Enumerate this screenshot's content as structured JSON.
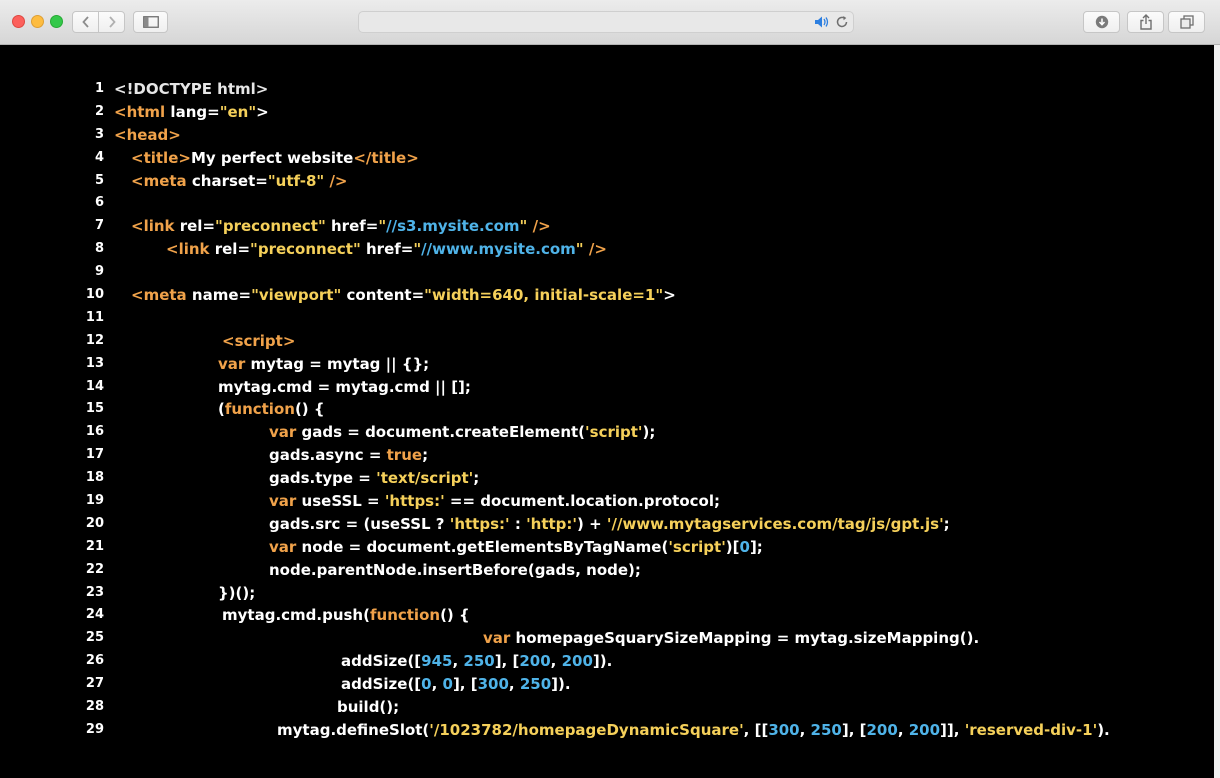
{
  "colors": {
    "tag": "#f0a24a",
    "keyword": "#f0a24a",
    "string": "#f5d05a",
    "url": "#4fb3e8",
    "number": "#4fb3e8",
    "plain": "#ffffff",
    "background": "#000000"
  },
  "toolbar": {
    "icons": [
      "close-icon",
      "minimize-icon",
      "zoom-icon",
      "back-icon",
      "forward-icon",
      "sidebar-icon",
      "speaker-icon",
      "reload-icon",
      "download-icon",
      "share-icon",
      "tabs-icon"
    ]
  },
  "code": {
    "lines": [
      {
        "n": "1",
        "indent": 114,
        "parts": [
          [
            "doc",
            "<!DOCTYPE html>"
          ]
        ]
      },
      {
        "n": "2",
        "indent": 114,
        "parts": [
          [
            "tag",
            "<html"
          ],
          [
            "plain",
            " lang="
          ],
          [
            "str",
            "\"en\""
          ],
          [
            "plain",
            ">"
          ]
        ]
      },
      {
        "n": "3",
        "indent": 114,
        "parts": [
          [
            "tag",
            "<head>"
          ]
        ]
      },
      {
        "n": "4",
        "indent": 131,
        "parts": [
          [
            "tag",
            "<title>"
          ],
          [
            "plain",
            "My perfect website"
          ],
          [
            "tag",
            "</title>"
          ]
        ]
      },
      {
        "n": "5",
        "indent": 131,
        "parts": [
          [
            "tag",
            "<meta"
          ],
          [
            "plain",
            " charset="
          ],
          [
            "str",
            "\"utf-8\""
          ],
          [
            "tag",
            " />"
          ]
        ]
      },
      {
        "n": "6",
        "indent": 131,
        "parts": []
      },
      {
        "n": "7",
        "indent": 131,
        "parts": [
          [
            "tag",
            "<link"
          ],
          [
            "plain",
            " rel="
          ],
          [
            "str",
            "\"preconnect\""
          ],
          [
            "plain",
            " href="
          ],
          [
            "str",
            "\""
          ],
          [
            "url",
            "//s3.mysite.com"
          ],
          [
            "str",
            "\""
          ],
          [
            "tag",
            " />"
          ]
        ]
      },
      {
        "n": "8",
        "indent": 166,
        "parts": [
          [
            "tag",
            "<link"
          ],
          [
            "plain",
            " rel="
          ],
          [
            "str",
            "\"preconnect\""
          ],
          [
            "plain",
            " href="
          ],
          [
            "str",
            "\""
          ],
          [
            "url",
            "//www.mysite.com"
          ],
          [
            "str",
            "\""
          ],
          [
            "tag",
            " />"
          ]
        ]
      },
      {
        "n": "9",
        "indent": 131,
        "parts": []
      },
      {
        "n": "10",
        "indent": 131,
        "parts": [
          [
            "tag",
            "<meta"
          ],
          [
            "plain",
            " name="
          ],
          [
            "str",
            "\"viewport\""
          ],
          [
            "plain",
            " content="
          ],
          [
            "str",
            "\"width=640, initial-scale=1\""
          ],
          [
            "plain",
            ">"
          ]
        ]
      },
      {
        "n": "11",
        "indent": 131,
        "parts": []
      },
      {
        "n": "12",
        "indent": 222,
        "parts": [
          [
            "tag",
            "<script>"
          ]
        ]
      },
      {
        "n": "13",
        "indent": 218,
        "parts": [
          [
            "kw",
            "var"
          ],
          [
            "plain",
            " mytag = mytag || {};"
          ]
        ]
      },
      {
        "n": "14",
        "indent": 218,
        "parts": [
          [
            "plain",
            "mytag.cmd = mytag.cmd || [];"
          ]
        ]
      },
      {
        "n": "15",
        "indent": 218,
        "parts": [
          [
            "plain",
            "("
          ],
          [
            "kw",
            "function"
          ],
          [
            "plain",
            "() {"
          ]
        ]
      },
      {
        "n": "16",
        "indent": 269,
        "parts": [
          [
            "kw",
            "var"
          ],
          [
            "plain",
            " gads = document.createElement("
          ],
          [
            "str",
            "'script'"
          ],
          [
            "plain",
            ");"
          ]
        ]
      },
      {
        "n": "17",
        "indent": 269,
        "parts": [
          [
            "plain",
            "gads.async = "
          ],
          [
            "kw",
            "true"
          ],
          [
            "plain",
            ";"
          ]
        ]
      },
      {
        "n": "18",
        "indent": 269,
        "parts": [
          [
            "plain",
            "gads.type = "
          ],
          [
            "str",
            "'text/script'"
          ],
          [
            "plain",
            ";"
          ]
        ]
      },
      {
        "n": "19",
        "indent": 269,
        "parts": [
          [
            "kw",
            "var"
          ],
          [
            "plain",
            " useSSL = "
          ],
          [
            "str",
            "'https:'"
          ],
          [
            "plain",
            " == document.location.protocol;"
          ]
        ]
      },
      {
        "n": "20",
        "indent": 269,
        "parts": [
          [
            "plain",
            "gads.src = (useSSL ? "
          ],
          [
            "str",
            "'https:'"
          ],
          [
            "plain",
            " : "
          ],
          [
            "str",
            "'http:'"
          ],
          [
            "plain",
            ") + "
          ],
          [
            "str",
            "'//www.mytagservices.com/tag/js/gpt.js'"
          ],
          [
            "plain",
            ";"
          ]
        ]
      },
      {
        "n": "21",
        "indent": 269,
        "parts": [
          [
            "kw",
            "var"
          ],
          [
            "plain",
            " node = document.getElementsByTagName("
          ],
          [
            "str",
            "'script'"
          ],
          [
            "plain",
            ")["
          ],
          [
            "num",
            "0"
          ],
          [
            "plain",
            "];"
          ]
        ]
      },
      {
        "n": "22",
        "indent": 269,
        "parts": [
          [
            "plain",
            "node.parentNode.insertBefore(gads, node);"
          ]
        ]
      },
      {
        "n": "23",
        "indent": 218,
        "parts": [
          [
            "plain",
            "})();"
          ]
        ]
      },
      {
        "n": "24",
        "indent": 222,
        "parts": [
          [
            "plain",
            "mytag.cmd.push("
          ],
          [
            "kw",
            "function"
          ],
          [
            "plain",
            "() {"
          ]
        ]
      },
      {
        "n": "25",
        "indent": 483,
        "parts": [
          [
            "kw",
            "var"
          ],
          [
            "plain",
            " homepageSquarySizeMapping = mytag.sizeMapping()."
          ]
        ]
      },
      {
        "n": "26",
        "indent": 341,
        "parts": [
          [
            "plain",
            "addSize(["
          ],
          [
            "num",
            "945"
          ],
          [
            "plain",
            ", "
          ],
          [
            "num",
            "250"
          ],
          [
            "plain",
            "], ["
          ],
          [
            "num",
            "200"
          ],
          [
            "plain",
            ", "
          ],
          [
            "num",
            "200"
          ],
          [
            "plain",
            "])."
          ]
        ]
      },
      {
        "n": "27",
        "indent": 341,
        "parts": [
          [
            "plain",
            "addSize(["
          ],
          [
            "num",
            "0"
          ],
          [
            "plain",
            ", "
          ],
          [
            "num",
            "0"
          ],
          [
            "plain",
            "], ["
          ],
          [
            "num",
            "300"
          ],
          [
            "plain",
            ", "
          ],
          [
            "num",
            "250"
          ],
          [
            "plain",
            "])."
          ]
        ]
      },
      {
        "n": "28",
        "indent": 337,
        "parts": [
          [
            "plain",
            "build();"
          ]
        ]
      },
      {
        "n": "29",
        "indent": 277,
        "parts": [
          [
            "plain",
            "mytag.defineSlot("
          ],
          [
            "str",
            "'/1023782/homepageDynamicSquare'"
          ],
          [
            "plain",
            ", [["
          ],
          [
            "num",
            "300"
          ],
          [
            "plain",
            ", "
          ],
          [
            "num",
            "250"
          ],
          [
            "plain",
            "], ["
          ],
          [
            "num",
            "200"
          ],
          [
            "plain",
            ", "
          ],
          [
            "num",
            "200"
          ],
          [
            "plain",
            "]], "
          ],
          [
            "str",
            "'reserved-div-1'"
          ],
          [
            "plain",
            ")."
          ]
        ]
      }
    ]
  }
}
